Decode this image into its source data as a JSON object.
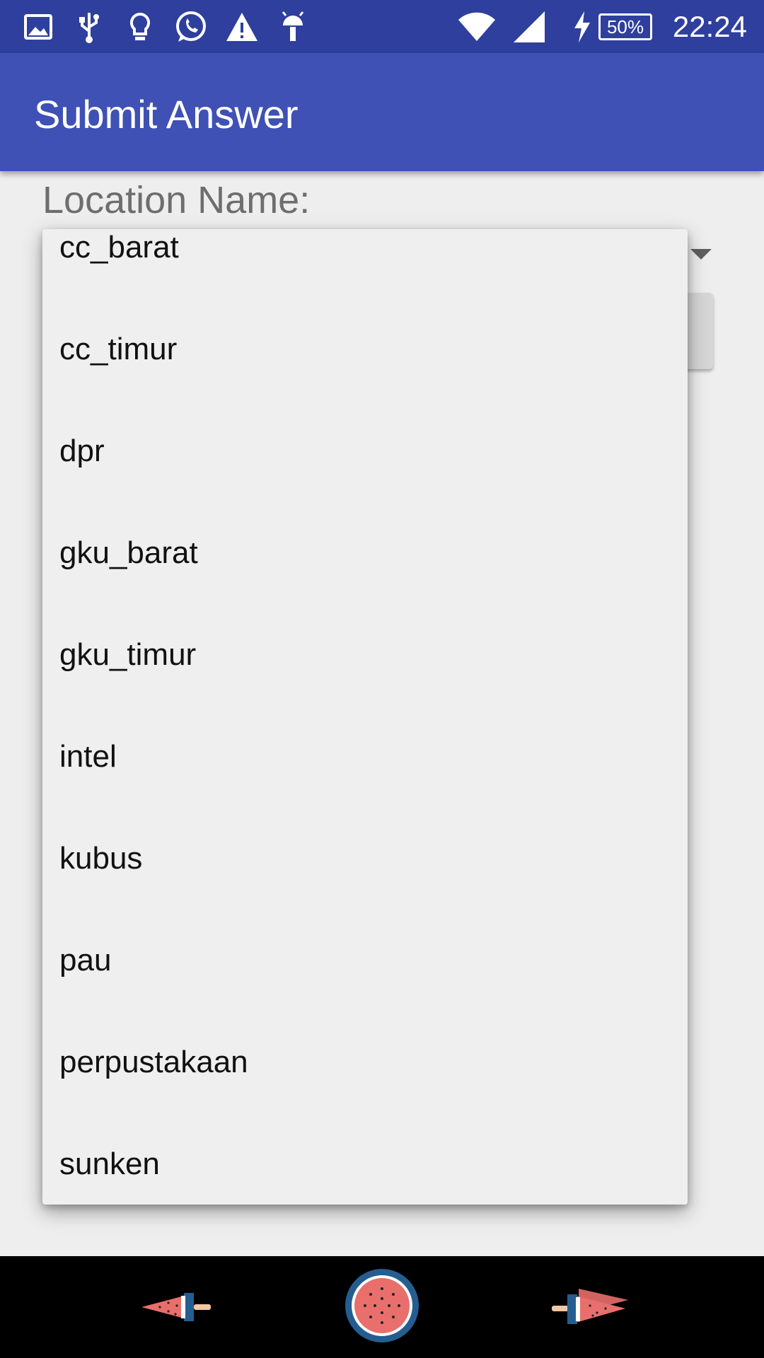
{
  "status_bar": {
    "icons": [
      "image-icon",
      "usb-icon",
      "bulb-icon",
      "whatsapp-icon",
      "warning-icon",
      "android-icon",
      "wifi-icon",
      "signal-icon",
      "charging-icon"
    ],
    "battery": "50%",
    "time": "22:24"
  },
  "app_bar": {
    "title": "Submit Answer",
    "color": "#3f51b5"
  },
  "form": {
    "location_label": "Location Name:"
  },
  "dropdown": {
    "items": [
      "cc_barat",
      "cc_timur",
      "dpr",
      "gku_barat",
      "gku_timur",
      "intel",
      "kubus",
      "pau",
      "perpustakaan",
      "sunken"
    ]
  },
  "nav_bar": {
    "buttons": [
      "back-button",
      "home-button",
      "recents-button"
    ]
  }
}
